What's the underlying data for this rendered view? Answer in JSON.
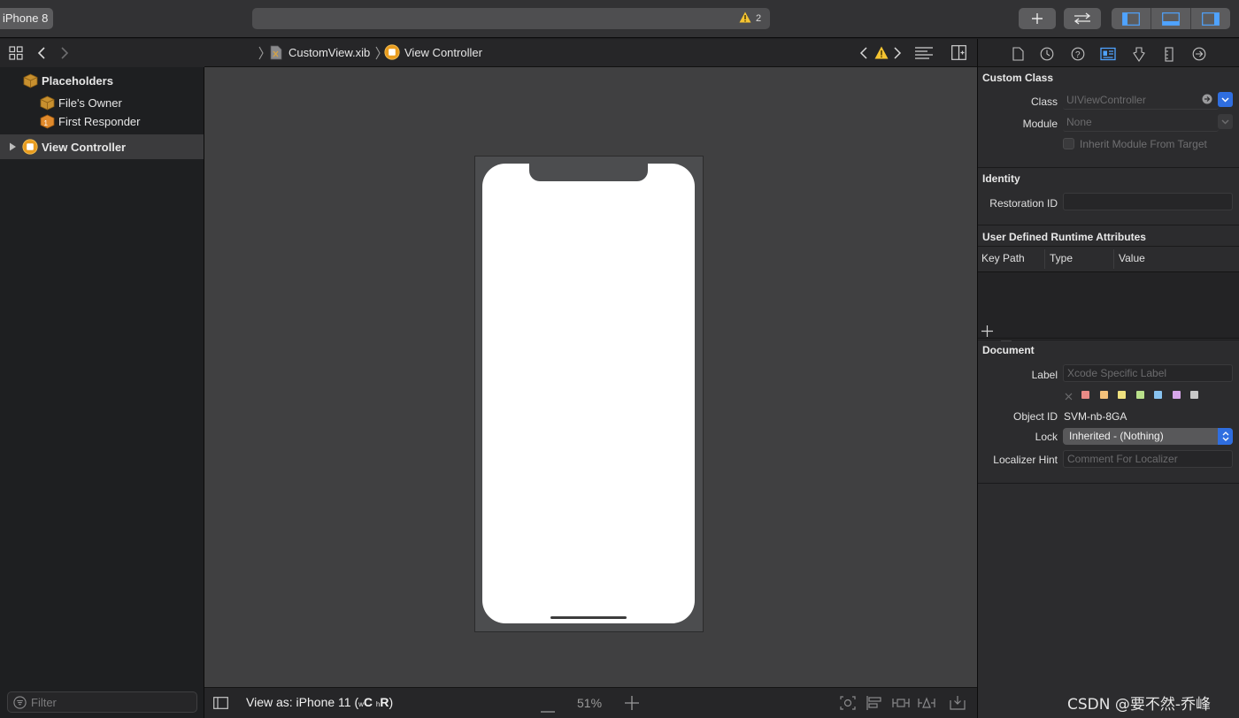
{
  "toolbar": {
    "scheme": "iPhone 8",
    "warning_count": "2"
  },
  "jumpbar": {
    "file": "CustomView.xib",
    "item": "View Controller"
  },
  "outline": {
    "placeholders": "Placeholders",
    "files_owner": "File's Owner",
    "first_responder": "First Responder",
    "view_controller": "View Controller"
  },
  "filter": {
    "placeholder": "Filter"
  },
  "editor_bottom": {
    "view_as_prefix": "View as: iPhone 11 (",
    "w_size": "w",
    "w_class": "C",
    "h_size": "h",
    "h_class": "R",
    "view_as_suffix": ")",
    "zoom": "51%"
  },
  "inspector": {
    "custom_class": {
      "title": "Custom Class",
      "class_label": "Class",
      "class_placeholder": "UIViewController",
      "module_label": "Module",
      "module_placeholder": "None",
      "inherit_label": "Inherit Module From Target"
    },
    "identity": {
      "title": "Identity",
      "restoration_label": "Restoration ID"
    },
    "uda": {
      "title": "User Defined Runtime Attributes",
      "col_key_path": "Key Path",
      "col_type": "Type",
      "col_value": "Value"
    },
    "document": {
      "title": "Document",
      "label_label": "Label",
      "label_placeholder": "Xcode Specific Label",
      "object_id_label": "Object ID",
      "object_id_value": "SVM-nb-8GA",
      "lock_label": "Lock",
      "lock_value": "Inherited - (Nothing)",
      "localizer_label": "Localizer Hint",
      "localizer_placeholder": "Comment For Localizer",
      "swatch_colors": [
        "#e98a86",
        "#f3c17a",
        "#efe17f",
        "#b9e08a",
        "#88c3f0",
        "#d7a6ea",
        "#c8c8c8"
      ]
    }
  },
  "watermark": "CSDN @要不然-乔峰"
}
